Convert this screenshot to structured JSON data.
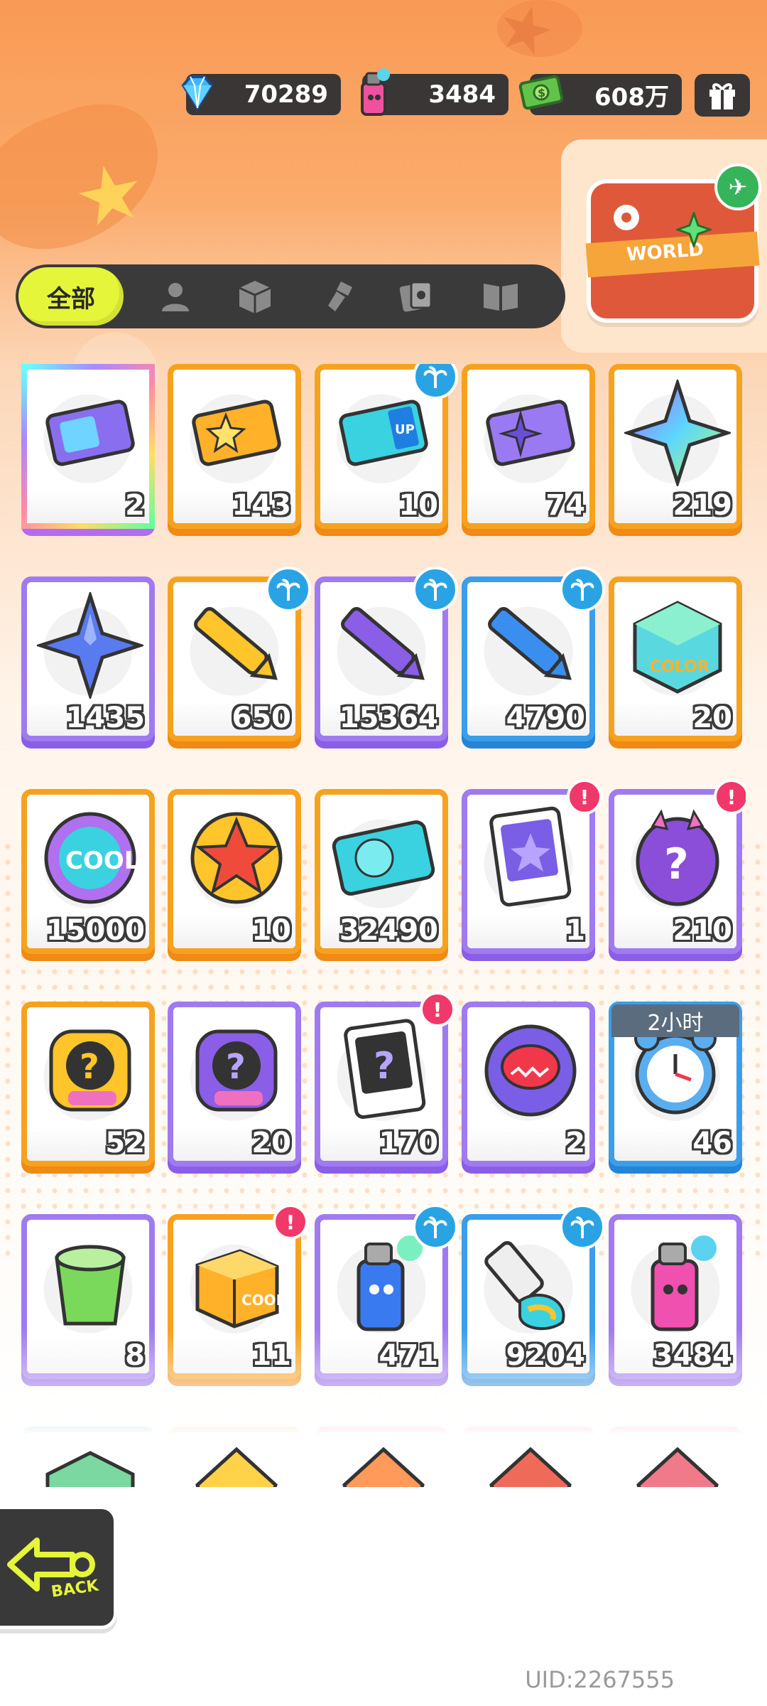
{
  "currency": {
    "diamond": "70289",
    "spray": "3484",
    "cash": "608万"
  },
  "world_label": "WORLD",
  "tabs": {
    "all": "全部",
    "icons": [
      "person-icon",
      "box-icon",
      "paint-brush-icon",
      "cards-icon",
      "book-icon"
    ]
  },
  "items": [
    {
      "count": "2",
      "frame": "rainbow",
      "icon": "purple-ticket-icon",
      "badge": null
    },
    {
      "count": "143",
      "frame": "orange",
      "icon": "gold-ticket-icon",
      "badge": null
    },
    {
      "count": "10",
      "frame": "orange",
      "icon": "up-ticket-icon",
      "badge": "palm"
    },
    {
      "count": "74",
      "frame": "orange",
      "icon": "star-ticket-icon",
      "badge": null
    },
    {
      "count": "219",
      "frame": "orange",
      "icon": "rainbow-star-icon",
      "badge": null
    },
    {
      "count": "1435",
      "frame": "purple",
      "icon": "blue-star-icon",
      "badge": null
    },
    {
      "count": "650",
      "frame": "orange",
      "icon": "yellow-crayon-icon",
      "badge": "palm"
    },
    {
      "count": "15364",
      "frame": "purple",
      "icon": "purple-crayon-icon",
      "badge": "palm"
    },
    {
      "count": "4790",
      "frame": "blue",
      "icon": "blue-crayon-icon",
      "badge": "palm"
    },
    {
      "count": "20",
      "frame": "orange",
      "icon": "color-block-icon",
      "badge": null
    },
    {
      "count": "15000",
      "frame": "orange",
      "icon": "cool-badge-icon",
      "badge": null
    },
    {
      "count": "10",
      "frame": "orange",
      "icon": "burst-coin-icon",
      "badge": null
    },
    {
      "count": "32490",
      "frame": "orange",
      "icon": "season-ticket-icon",
      "badge": null
    },
    {
      "count": "1",
      "frame": "purple",
      "icon": "travel-card-icon",
      "badge": "alert"
    },
    {
      "count": "210",
      "frame": "purple",
      "icon": "mystery-egg-icon",
      "badge": "alert"
    },
    {
      "count": "52",
      "frame": "orange",
      "icon": "deity-gold-mystery-icon",
      "badge": null
    },
    {
      "count": "20",
      "frame": "purple",
      "icon": "deity-purple-mystery-icon",
      "badge": null
    },
    {
      "count": "170",
      "frame": "purple",
      "icon": "travel-mystery-card-icon",
      "badge": "alert"
    },
    {
      "count": "2",
      "frame": "purple",
      "icon": "piranha-coin-icon",
      "badge": null
    },
    {
      "count": "46",
      "frame": "blue",
      "icon": "alarm-clock-icon",
      "badge": null,
      "timer": "2小时"
    },
    {
      "count": "8",
      "frame": "purple",
      "icon": "green-cup-icon",
      "badge": null
    },
    {
      "count": "11",
      "frame": "orange",
      "icon": "cool-box-icon",
      "badge": "alert"
    },
    {
      "count": "471",
      "frame": "purple",
      "icon": "blue-spray-can-icon",
      "badge": "palm"
    },
    {
      "count": "9204",
      "frame": "blue",
      "icon": "paint-tube-icon",
      "badge": "palm"
    },
    {
      "count": "3484",
      "frame": "purple",
      "icon": "pink-spray-can-icon",
      "badge": null
    },
    {
      "count": "",
      "frame": "blue",
      "icon": "green-cube-icon",
      "badge": null
    },
    {
      "count": "",
      "frame": "orange",
      "icon": "gold-crystal-icon",
      "badge": null
    },
    {
      "count": "",
      "frame": "pink",
      "icon": "orange-crystal-icon",
      "badge": null
    },
    {
      "count": "",
      "frame": "pink",
      "icon": "red-crystal-icon",
      "badge": null
    },
    {
      "count": "",
      "frame": "pink",
      "icon": "pink-crystal-icon",
      "badge": null
    }
  ],
  "back_label": "BACK",
  "uid": "UID:2267555"
}
